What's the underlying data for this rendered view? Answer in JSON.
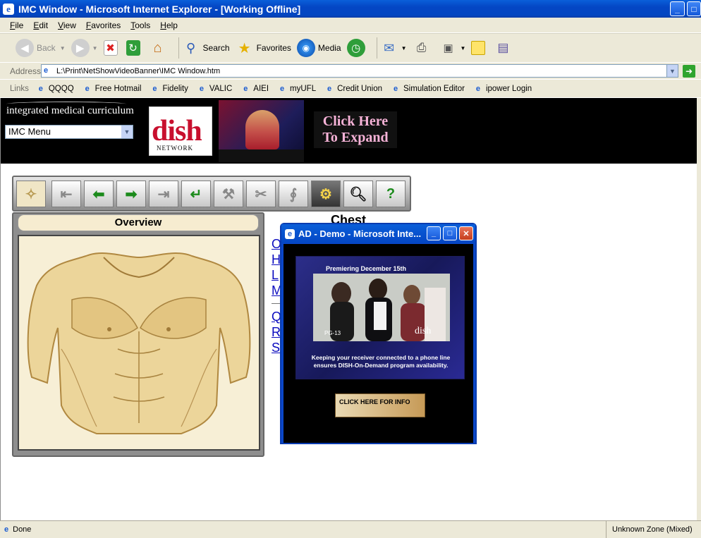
{
  "window": {
    "title": "IMC Window - Microsoft Internet Explorer - [Working Offline]"
  },
  "menu": [
    "File",
    "Edit",
    "View",
    "Favorites",
    "Tools",
    "Help"
  ],
  "toolbar": {
    "back": "Back",
    "search": "Search",
    "favorites": "Favorites",
    "media": "Media"
  },
  "address": {
    "label": "Address",
    "url": "L:\\Print\\NetShowVideoBanner\\IMC Window.htm"
  },
  "links": {
    "label": "Links",
    "items": [
      "QQQQ",
      "Free Hotmail",
      "Fidelity",
      "VALIC",
      "AIEI",
      "myUFL",
      "Credit Union",
      "Simulation Editor",
      "ipower Login"
    ]
  },
  "banner": {
    "site_title": "integrated medical curriculum",
    "menu_select": "IMC Menu",
    "dish_logo": "dish",
    "dish_sub": "NETWORK",
    "expand_button": "Click Here To Expand"
  },
  "panel": {
    "overview_title": "Overview",
    "chest_title": "Chest",
    "links": [
      "O",
      "H",
      "L",
      "M",
      "Q",
      "R",
      "S"
    ]
  },
  "popup": {
    "title": "AD - Demo - Microsoft Inte...",
    "premiere": "Premiering December 15th",
    "rating": "PG-13",
    "video_logo": "dish",
    "message": "Keeping your receiver connected to a phone line ensures DISH-On-Demand program availability.",
    "info_button": "CLICK HERE FOR INFO"
  },
  "status": {
    "text": "Done",
    "zone": "Unknown Zone (Mixed)"
  }
}
